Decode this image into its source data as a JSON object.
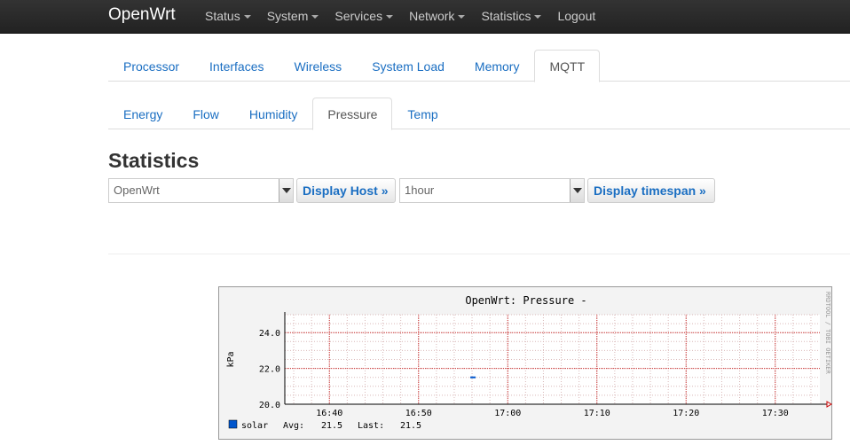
{
  "navbar": {
    "brand": "OpenWrt",
    "menu": [
      {
        "label": "Status",
        "dropdown": true
      },
      {
        "label": "System",
        "dropdown": true
      },
      {
        "label": "Services",
        "dropdown": true
      },
      {
        "label": "Network",
        "dropdown": true
      },
      {
        "label": "Statistics",
        "dropdown": true
      },
      {
        "label": "Logout",
        "dropdown": false
      }
    ]
  },
  "tabs_primary": [
    "Processor",
    "Interfaces",
    "Wireless",
    "System Load",
    "Memory",
    "MQTT"
  ],
  "tabs_primary_active": "MQTT",
  "tabs_secondary": [
    "Energy",
    "Flow",
    "Humidity",
    "Pressure",
    "Temp"
  ],
  "tabs_secondary_active": "Pressure",
  "page": {
    "title": "Statistics"
  },
  "controls": {
    "host_select": "OpenWrt",
    "host_button": "Display Host »",
    "timespan_select": "1hour",
    "timespan_button": "Display timespan »"
  },
  "colors": {
    "link": "#1a6ec2",
    "navbar": "#222222",
    "series": "#0055cc",
    "major_grid": "#cc0000"
  },
  "chart_data": {
    "type": "line",
    "title": "OpenWrt: Pressure -",
    "ylabel": "kPa",
    "watermark": "RRDTOOL / TOBI OETIKER",
    "ylim": [
      20.0,
      25.0
    ],
    "y_ticks": [
      "20.0",
      "22.0",
      "24.0"
    ],
    "x_ticks": [
      "16:40",
      "16:50",
      "17:00",
      "17:10",
      "17:20",
      "17:30"
    ],
    "xlim": [
      "16:35",
      "17:35"
    ],
    "grid": true,
    "series": [
      {
        "name": "solar",
        "color": "#0055cc",
        "x": [
          "16:56",
          "16:56"
        ],
        "values": [
          21.5,
          21.5
        ]
      }
    ],
    "legend": {
      "entries": [
        {
          "name": "solar",
          "avg_label": "Avg:",
          "avg": "21.5",
          "last_label": "Last:",
          "last": "21.5"
        }
      ]
    }
  }
}
